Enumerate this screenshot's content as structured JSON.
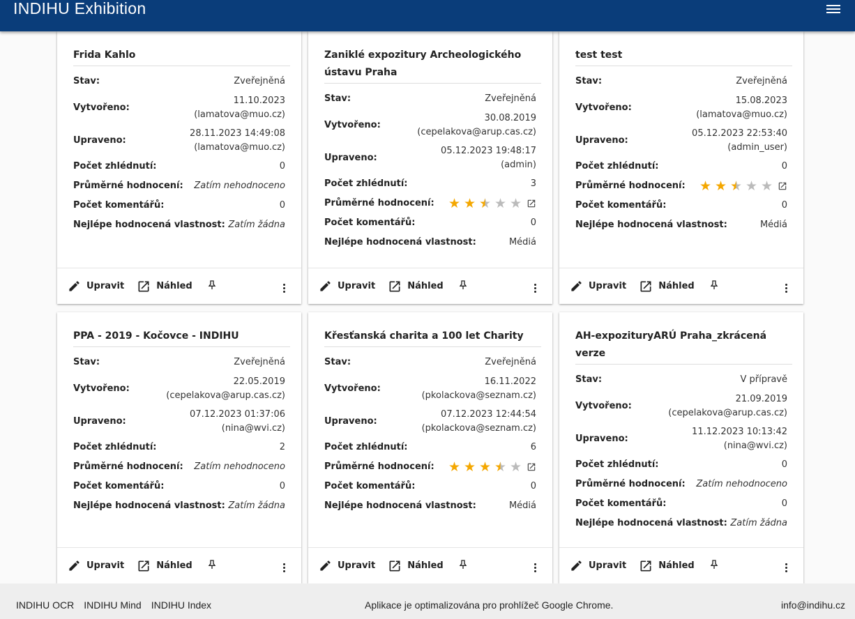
{
  "header": {
    "title": "INDIHU Exhibition",
    "menu_icon": "menu-icon"
  },
  "labels": {
    "status": "Stav:",
    "created": "Vytvořeno:",
    "updated": "Upraveno:",
    "views": "Počet zhlédnutí:",
    "avg_rating": "Průměrné hodnocení:",
    "comments": "Počet komentářů:",
    "best_feature": "Nejlépe hodnocená vlastnost:"
  },
  "actions": {
    "edit": "Upravit",
    "preview": "Náhled"
  },
  "colors": {
    "header_bg": "#0a3d7a",
    "star": "#f4a700"
  },
  "cards": [
    {
      "title": "Frida Kahlo",
      "status": "Zveřejněná",
      "created_date": "11.10.2023",
      "created_by": "(lamatova@muo.cz)",
      "updated_date": "28.11.2023 14:49:08",
      "updated_by": "(lamatova@muo.cz)",
      "views": "0",
      "rating": null,
      "rating_text": "Zatím nehodnoceno",
      "comments": "0",
      "best": "Zatím žádna"
    },
    {
      "title": "Zaniklé expozitury Archeologického ústavu Praha",
      "status": "Zveřejněná",
      "created_date": "30.08.2019",
      "created_by": "(cepelakova@arup.cas.cz)",
      "updated_date": "05.12.2023 19:48:17",
      "updated_by": "(admin)",
      "views": "3",
      "rating": 2.5,
      "rating_text": "",
      "comments": "0",
      "best": "Médiá"
    },
    {
      "title": "test test",
      "status": "Zveřejněná",
      "created_date": "15.08.2023",
      "created_by": "(lamatova@muo.cz)",
      "updated_date": "05.12.2023 22:53:40",
      "updated_by": "(admin_user)",
      "views": "0",
      "rating": 2.5,
      "rating_text": "",
      "comments": "0",
      "best": "Médiá"
    },
    {
      "title": "PPA - 2019 - Kočovce - INDIHU",
      "status": "Zveřejněná",
      "created_date": "22.05.2019",
      "created_by": "(cepelakova@arup.cas.cz)",
      "updated_date": "07.12.2023 01:37:06",
      "updated_by": "(nina@wvi.cz)",
      "views": "2",
      "rating": null,
      "rating_text": "Zatím nehodnoceno",
      "comments": "0",
      "best": "Zatím žádna"
    },
    {
      "title": "Křesťanská charita a 100 let Charity",
      "status": "Zveřejněná",
      "created_date": "16.11.2022",
      "created_by": "(pkolackova@seznam.cz)",
      "updated_date": "07.12.2023 12:44:54",
      "updated_by": "(pkolackova@seznam.cz)",
      "views": "6",
      "rating": 3.5,
      "rating_text": "",
      "comments": "0",
      "best": "Médiá"
    },
    {
      "title": "AH-expozituryARÚ Praha_zkrácená verze",
      "status": "V přípravě",
      "created_date": "21.09.2019",
      "created_by": "(cepelakova@arup.cas.cz)",
      "updated_date": "11.12.2023 10:13:42",
      "updated_by": "(nina@wvi.cz)",
      "views": "0",
      "rating": null,
      "rating_text": "Zatím nehodnoceno",
      "comments": "0",
      "best": "Zatím žádna"
    }
  ],
  "footer": {
    "links": [
      "INDIHU OCR",
      "INDIHU Mind",
      "INDIHU Index"
    ],
    "note": "Aplikace je optimalizována pro prohlížeč Google Chrome.",
    "email": "info@indihu.cz"
  }
}
